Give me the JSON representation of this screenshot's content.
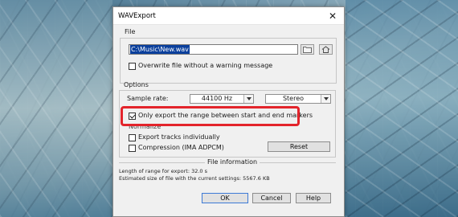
{
  "window": {
    "title": "WAVExport",
    "close_glyph": "✕"
  },
  "file_section": {
    "label": "File",
    "path_value": "C:\\Music\\New.wav",
    "overwrite_label": "Overwrite file without a warning message",
    "overwrite_checked": false
  },
  "options_section": {
    "label": "Options",
    "sample_rate_label": "Sample rate:",
    "sample_rate_value": "44100 Hz",
    "channel_value": "Stereo",
    "only_range_label": "Only export the range between start and end markers",
    "only_range_checked": true,
    "normalize_label": "Normalize",
    "export_tracks_label": "Export tracks individually",
    "compression_label": "Compression (IMA ADPCM)",
    "reset_label": "Reset"
  },
  "file_information": {
    "label": "File information",
    "range_length": "Length of range for export: 32.0 s",
    "estimated_size": "Estimated size of file with the current settings: 5567.6 KB"
  },
  "buttons": {
    "ok": "OK",
    "cancel": "Cancel",
    "help": "Help"
  },
  "colors": {
    "highlight": "#e3242b",
    "selection": "#0a3f9c",
    "dialog_bg": "#f0f0f0"
  }
}
